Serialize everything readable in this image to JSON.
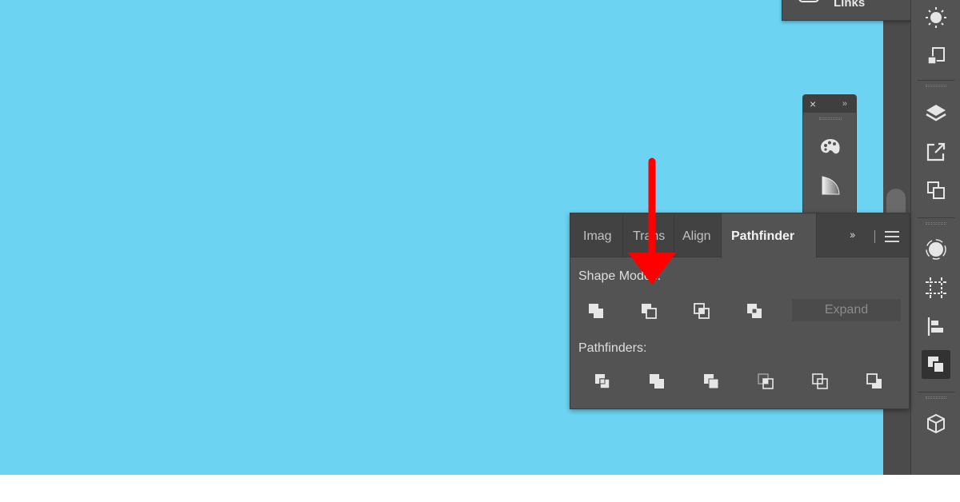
{
  "flyout": {
    "label": "Links"
  },
  "pathfinder_panel": {
    "tabs": [
      {
        "label": "Imag",
        "active": false
      },
      {
        "label": "Trans",
        "active": false
      },
      {
        "label": "Align",
        "active": false
      },
      {
        "label": "Pathfinder",
        "active": true
      }
    ],
    "shape_modes_label": "Shape Modes:",
    "shape_modes": [
      "unite-icon",
      "minus-front-icon",
      "intersect-icon",
      "exclude-icon"
    ],
    "expand_label": "Expand",
    "pathfinders_label": "Pathfinders:",
    "pathfinders": [
      "divide-icon",
      "trim-icon",
      "merge-icon",
      "crop-icon",
      "outline-icon",
      "minus-back-icon"
    ]
  },
  "mini_panel": {
    "close_glyph": "×",
    "collapse_glyph": "»",
    "icons": [
      "color-palette-icon",
      "gradient-icon"
    ]
  },
  "dock": {
    "icons": [
      "sun-icon",
      "artboards-icon",
      "layers-icon",
      "export-icon",
      "transform-icon",
      "recolor-icon",
      "crop-marks-icon",
      "align-icon",
      "pathfinder-icon",
      "3d-cube-icon"
    ],
    "active_icon": "pathfinder-icon"
  },
  "annotation": {
    "arrow_color": "#ff0000"
  },
  "colors": {
    "canvas": "#6cd4f2",
    "panel": "#535353",
    "tabbar": "#424242"
  }
}
